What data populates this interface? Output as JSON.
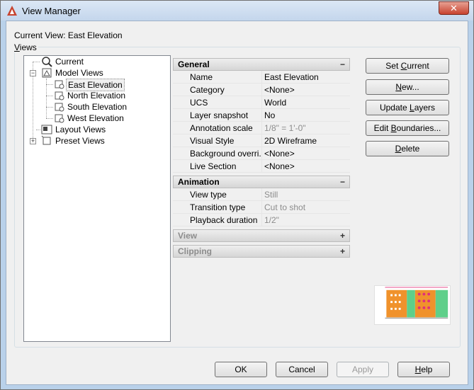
{
  "window": {
    "title": "View Manager",
    "close_label": "✕"
  },
  "current_view": {
    "label": "Current View:",
    "value": "East Elevation"
  },
  "views_group": {
    "label_accel": "V",
    "label_rest": "iews"
  },
  "tree": {
    "current": "Current",
    "model_views": "Model Views",
    "model_children": [
      "East Elevation",
      "North Elevation",
      "South Elevation",
      "West Elevation"
    ],
    "layout_views": "Layout Views",
    "preset_views": "Preset Views",
    "collapse_sign": "−",
    "expand_sign": "+"
  },
  "sections": {
    "general": {
      "title": "General",
      "sign": "−"
    },
    "animation": {
      "title": "Animation",
      "sign": "−"
    },
    "view": {
      "title": "View",
      "sign": "+"
    },
    "clipping": {
      "title": "Clipping",
      "sign": "+"
    }
  },
  "general_props": [
    {
      "key": "Name",
      "value": "East Elevation"
    },
    {
      "key": "Category",
      "value": "<None>"
    },
    {
      "key": "UCS",
      "value": "World"
    },
    {
      "key": "Layer snapshot",
      "value": "No"
    },
    {
      "key": "Annotation scale",
      "value": "1/8\" = 1'-0\""
    },
    {
      "key": "Visual Style",
      "value": "2D Wireframe"
    },
    {
      "key": "Background overri...",
      "value": "<None>"
    },
    {
      "key": "Live Section",
      "value": "<None>"
    }
  ],
  "animation_props": [
    {
      "key": "View type",
      "value": "Still"
    },
    {
      "key": "Transition type",
      "value": "Cut to shot"
    },
    {
      "key": "Playback duration",
      "value": "1/2\""
    }
  ],
  "side_buttons": {
    "set_current_pre": "Set ",
    "set_current_accel": "C",
    "set_current_post": "urrent",
    "new_accel": "N",
    "new_post": "ew...",
    "update_layers_pre": "Update ",
    "update_layers_accel": "L",
    "update_layers_post": "ayers",
    "edit_boundaries_pre": "Edit ",
    "edit_boundaries_accel": "B",
    "edit_boundaries_post": "oundaries...",
    "delete_accel": "D",
    "delete_post": "elete"
  },
  "footer_buttons": {
    "ok": "OK",
    "cancel": "Cancel",
    "apply": "Apply",
    "help_accel": "H",
    "help_post": "elp"
  },
  "colors": {
    "accent_red": "#c7432f",
    "preview_orange": "#f0922c",
    "preview_green": "#5fcf8a",
    "preview_pink": "#e0307a"
  }
}
